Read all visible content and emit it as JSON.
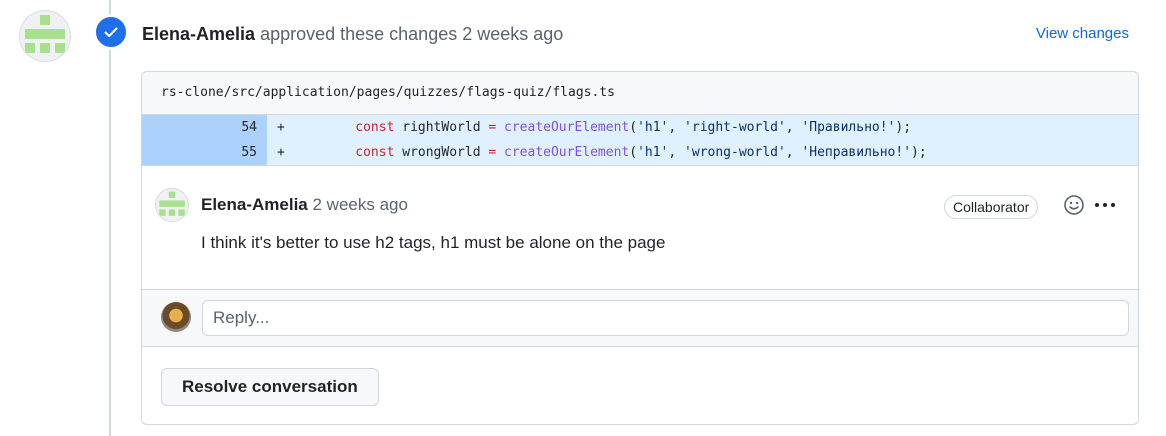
{
  "review": {
    "author": "Elena-Amelia",
    "action": "approved these changes",
    "time": "2 weeks ago",
    "view_changes_label": "View changes",
    "badge_icon": "check-icon",
    "badge_color": "#1f6feb"
  },
  "file": {
    "path": "rs-clone/src/application/pages/quizzes/flags-quiz/flags.ts"
  },
  "diff": [
    {
      "line": "54",
      "sign": "+",
      "indent": "        ",
      "keyword": "const",
      "var": "rightWorld",
      "op": "=",
      "fn": "createOurElement",
      "args": [
        "'h1'",
        "'right-world'",
        "'Правильно!'"
      ]
    },
    {
      "line": "55",
      "sign": "+",
      "indent": "        ",
      "keyword": "const",
      "var": "wrongWorld",
      "op": "=",
      "fn": "createOurElement",
      "args": [
        "'h1'",
        "'wrong-world'",
        "'Неправильно!'"
      ]
    }
  ],
  "comment": {
    "author": "Elena-Amelia",
    "time": "2 weeks ago",
    "role": "Collaborator",
    "body": "I think it's better to use h2 tags, h1 must be alone on the page",
    "reaction_icon": "smiley-icon",
    "more_icon": "kebab-horizontal-icon"
  },
  "reply": {
    "placeholder": "Reply..."
  },
  "resolve_label": "Resolve conversation",
  "colors": {
    "accent": "#0969da",
    "diff_number_bg": "#acd1fb",
    "diff_code_bg": "#dff1ff",
    "identicon": "#a7e08e"
  }
}
